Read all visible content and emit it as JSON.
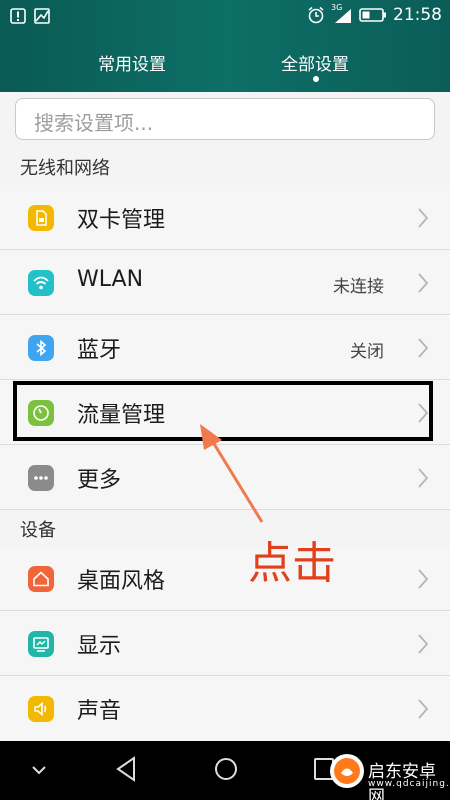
{
  "status_bar": {
    "time": "21:58",
    "network_label": "3G",
    "icons": [
      "info-icon",
      "image-icon",
      "alarm-icon",
      "signal-icon",
      "battery-icon"
    ]
  },
  "tabs": {
    "common": "常用设置",
    "all": "全部设置"
  },
  "search": {
    "placeholder": "搜索设置项..."
  },
  "sections": [
    {
      "title": "无线和网络",
      "items": [
        {
          "label": "双卡管理",
          "value": "",
          "icon": "sim-card-icon",
          "color": "#f5b800"
        },
        {
          "label": "WLAN",
          "value": "未连接",
          "icon": "wifi-icon",
          "color": "#22c0c8"
        },
        {
          "label": "蓝牙",
          "value": "关闭",
          "icon": "bluetooth-icon",
          "color": "#3fa5f0"
        },
        {
          "label": "流量管理",
          "value": "",
          "icon": "data-usage-icon",
          "color": "#7cc13d"
        },
        {
          "label": "更多",
          "value": "",
          "icon": "more-icon",
          "color": "#8b8b8b"
        }
      ]
    },
    {
      "title": "设备",
      "items": [
        {
          "label": "桌面风格",
          "value": "",
          "icon": "home-style-icon",
          "color": "#f0663a"
        },
        {
          "label": "显示",
          "value": "",
          "icon": "display-icon",
          "color": "#21b7a8"
        },
        {
          "label": "声音",
          "value": "",
          "icon": "sound-icon",
          "color": "#f5b800"
        }
      ]
    }
  ],
  "annotation": {
    "text": "点击",
    "color": "#e0411b"
  },
  "watermark": {
    "text": "启东安卓网",
    "sub": "www.qdcaijing.com"
  }
}
